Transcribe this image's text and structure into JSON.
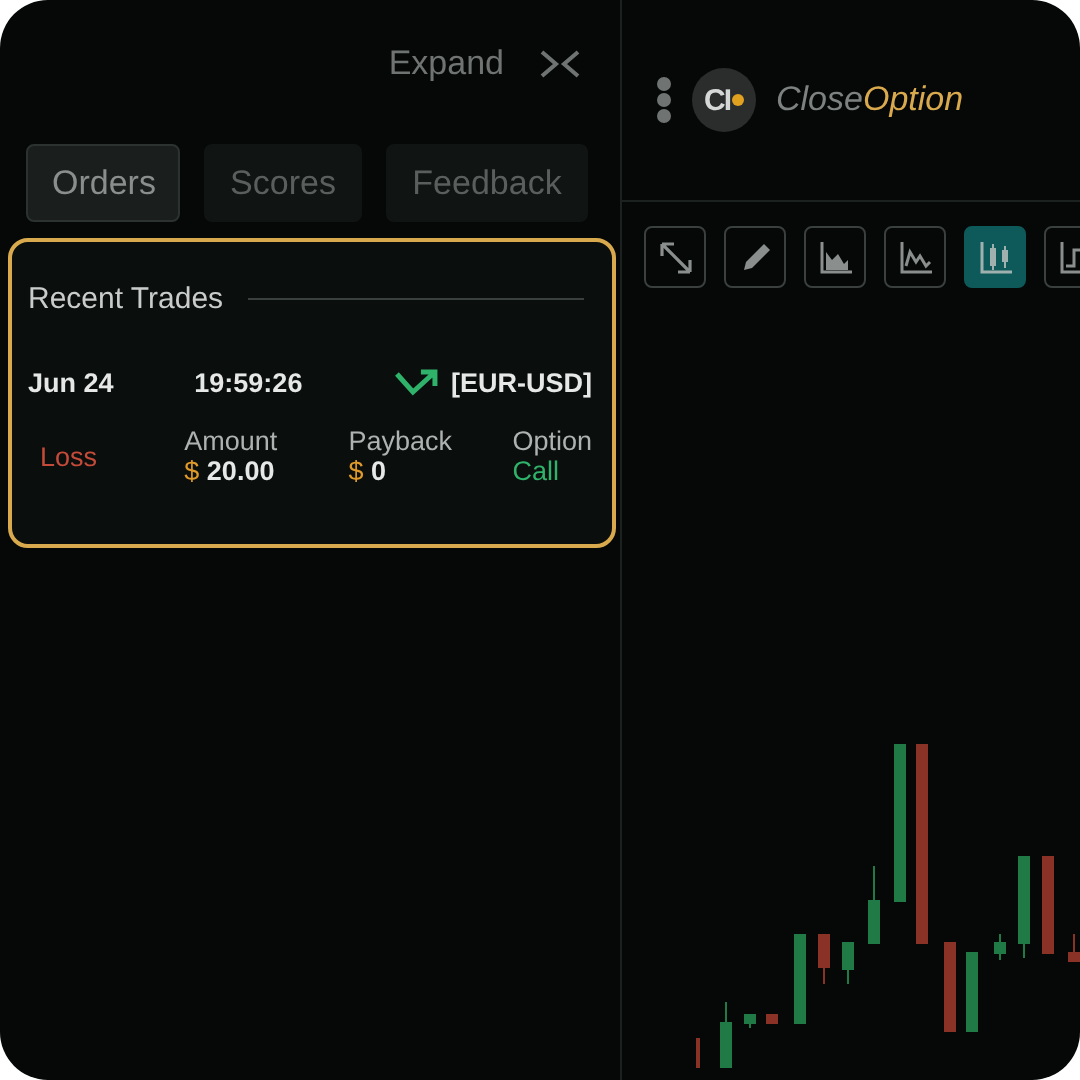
{
  "panel": {
    "expand_label": "Expand"
  },
  "tabs": [
    {
      "label": "Orders",
      "selected": true
    },
    {
      "label": "Scores",
      "selected": false
    },
    {
      "label": "Feedback",
      "selected": false
    }
  ],
  "recent_trades": {
    "title": "Recent Trades",
    "trades": [
      {
        "date": "Jun 24",
        "time": "19:59:26",
        "rising": true,
        "pair": "[EUR-USD]",
        "loss": true,
        "outcome_label": "Loss",
        "amount_label": "Amount",
        "amount_currency": "$",
        "amount": "20.00",
        "payback_label": "Payback",
        "payback_currency": "$",
        "payback": "0",
        "option_label": "Option",
        "option": "Call"
      }
    ]
  },
  "brand": {
    "logo_mark": "CI",
    "name": "Close",
    "name_accent": "Option"
  },
  "tools": [
    {
      "kind": "expand",
      "selected": false
    },
    {
      "kind": "pencil",
      "selected": false
    },
    {
      "kind": "area",
      "selected": false
    },
    {
      "kind": "line",
      "selected": false
    },
    {
      "kind": "candles",
      "selected": true
    },
    {
      "kind": "step",
      "selected": false
    }
  ]
}
